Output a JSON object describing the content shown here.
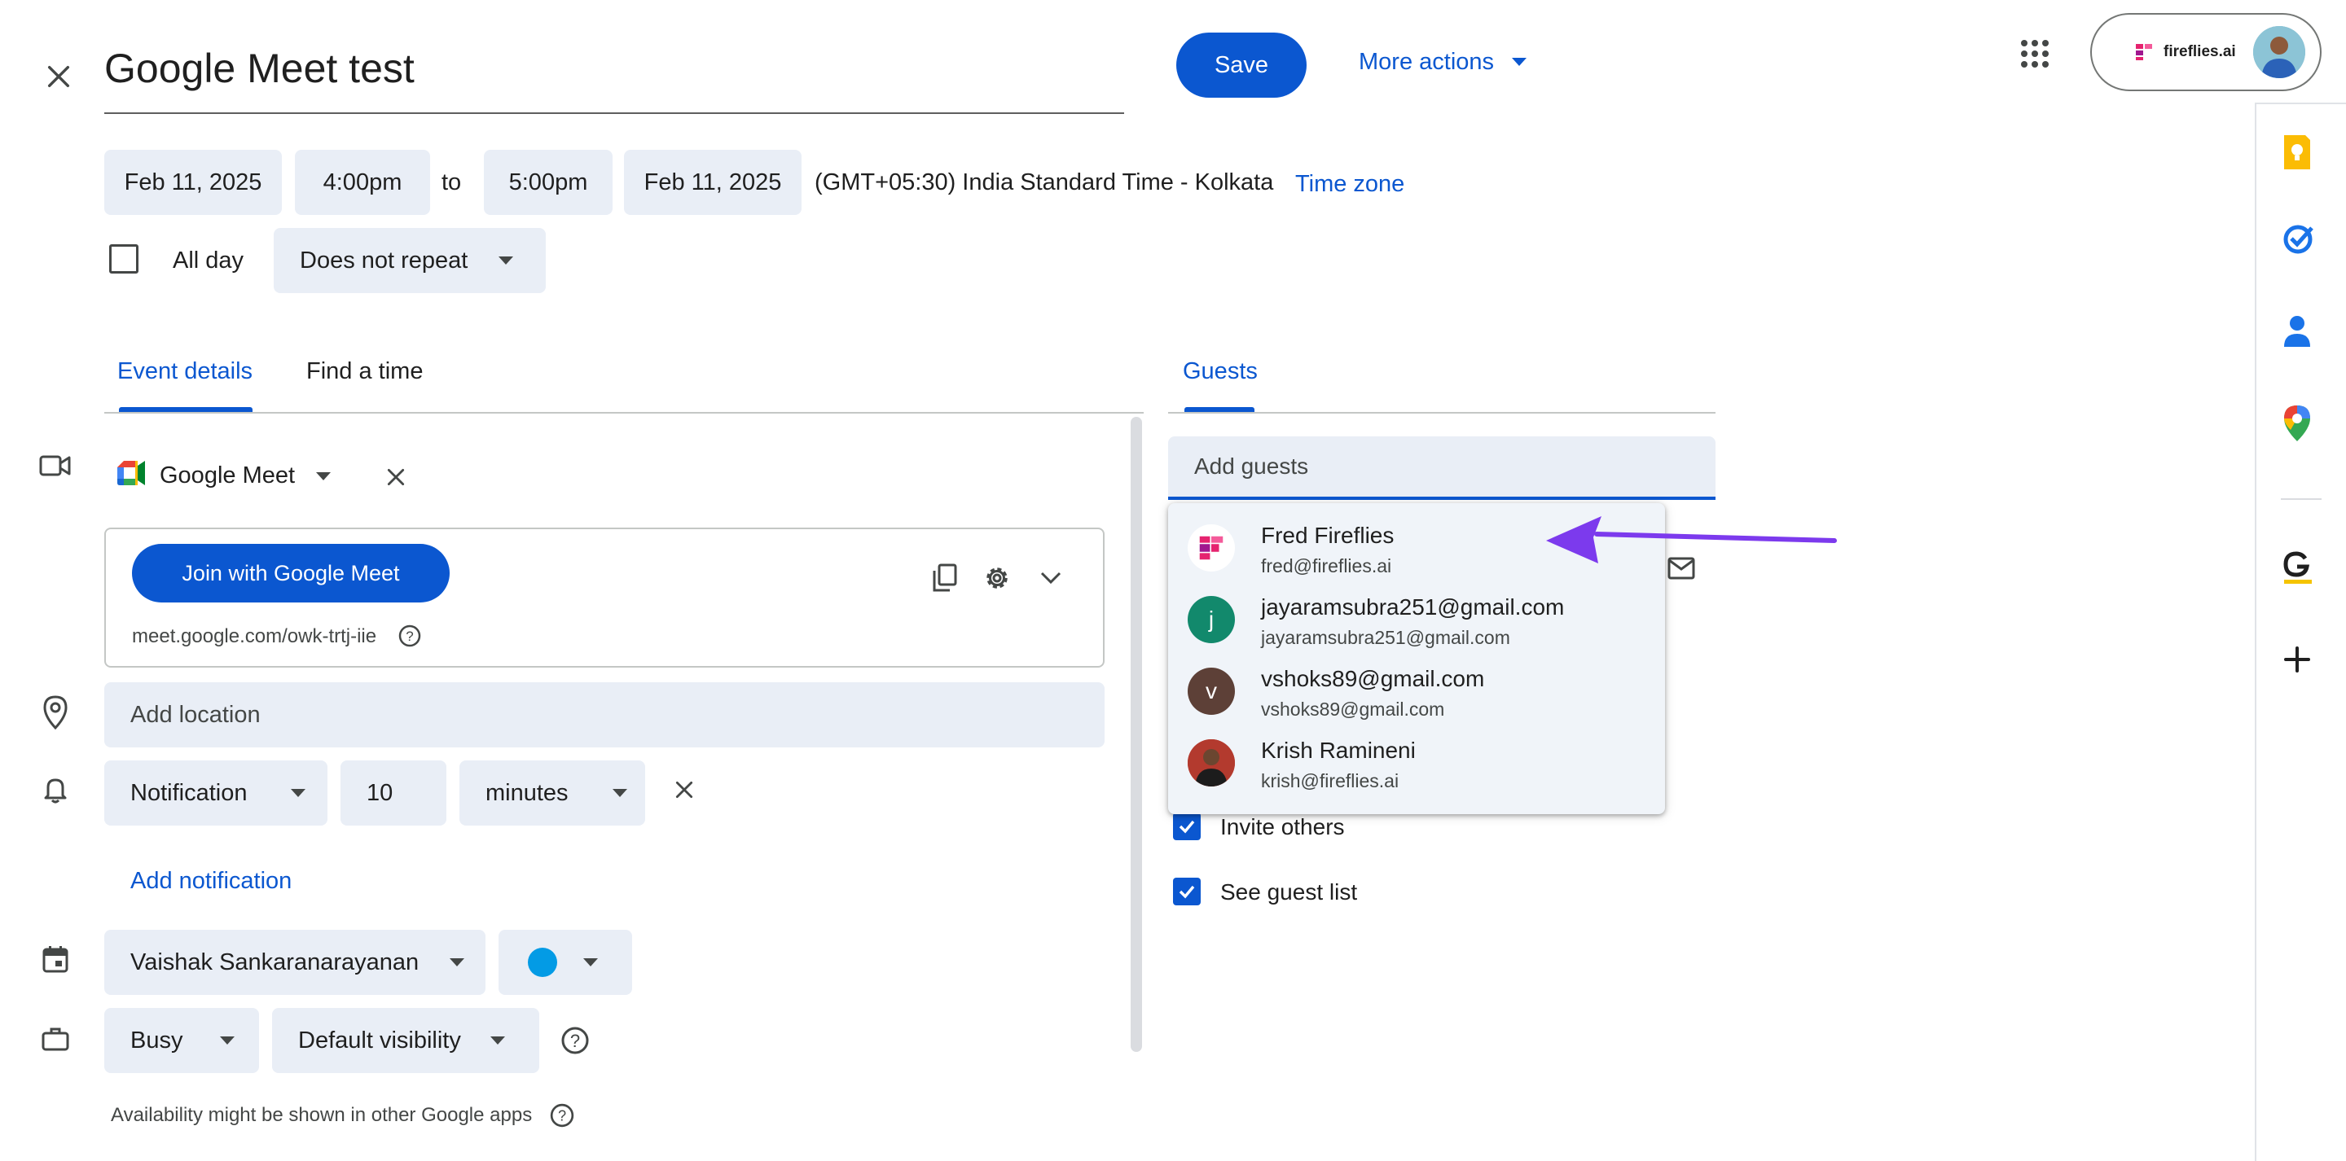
{
  "header": {
    "title_value": "Google Meet test",
    "save_label": "Save",
    "more_actions_label": "More actions",
    "account_brand": "fireflies.ai"
  },
  "datetime": {
    "start_date": "Feb 11, 2025",
    "start_time": "4:00pm",
    "to_label": "to",
    "end_time": "5:00pm",
    "end_date": "Feb 11, 2025",
    "timezone_text": "(GMT+05:30) India Standard Time - Kolkata",
    "timezone_link": "Time zone",
    "all_day_label": "All day",
    "repeat_value": "Does not repeat"
  },
  "tabs": {
    "event_details": "Event details",
    "find_a_time": "Find a time",
    "guests": "Guests"
  },
  "conferencing": {
    "provider": "Google Meet",
    "join_label": "Join with Google Meet",
    "meet_link": "meet.google.com/owk-trtj-iie"
  },
  "location": {
    "placeholder": "Add location"
  },
  "notification": {
    "type": "Notification",
    "amount": "10",
    "unit": "minutes",
    "add_label": "Add notification"
  },
  "calendar": {
    "owner": "Vaishak Sankaranarayanan",
    "color": "#039be5"
  },
  "availability": {
    "status": "Busy",
    "visibility": "Default visibility",
    "note": "Availability might be shown in other Google apps"
  },
  "guests": {
    "placeholder": "Add guests",
    "suggestions": [
      {
        "name": "Fred Fireflies",
        "email": "fred@fireflies.ai",
        "avatar": ""
      },
      {
        "name": "jayaramsubra251@gmail.com",
        "email": "jayaramsubra251@gmail.com",
        "avatar": "j"
      },
      {
        "name": "vshoks89@gmail.com",
        "email": "vshoks89@gmail.com",
        "avatar": "v"
      },
      {
        "name": "Krish Ramineni",
        "email": "krish@fireflies.ai",
        "avatar": ""
      }
    ],
    "permissions": {
      "invite_others": "Invite others",
      "see_guest_list": "See guest list"
    }
  },
  "colors": {
    "accent": "#0b57d0",
    "field_bg": "#e9eef6",
    "arrow": "#7c3aed"
  },
  "sidebar_icons": [
    "keep-icon",
    "tasks-icon",
    "contacts-icon",
    "maps-icon",
    "grammarly-icon",
    "add-addon-icon"
  ]
}
